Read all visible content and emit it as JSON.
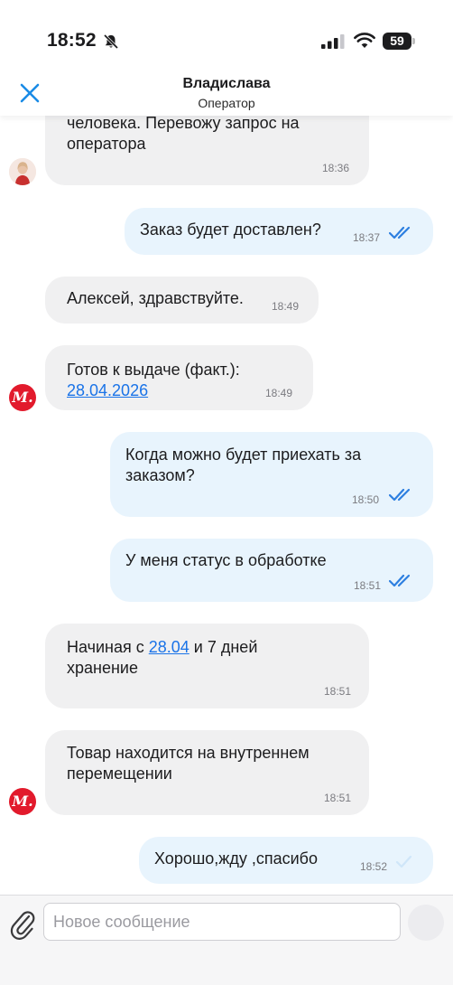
{
  "status_bar": {
    "time": "18:52",
    "battery": "59",
    "icons": [
      "bell-muted-icon",
      "cellular-signal-icon",
      "wifi-icon",
      "battery-icon"
    ]
  },
  "header": {
    "title": "Владислава",
    "subtitle": "Оператор",
    "close_icon": "close-icon"
  },
  "messages": [
    {
      "direction": "incoming",
      "avatar": "operator-photo",
      "lines": [
        "человека. Перевожу запрос на",
        "оператора"
      ],
      "time": "18:36"
    },
    {
      "direction": "outgoing",
      "text": "Заказ будет доставлен?",
      "time": "18:37",
      "status": "read"
    },
    {
      "direction": "incoming",
      "text": "Алексей, здравствуйте.",
      "time": "18:49"
    },
    {
      "direction": "incoming",
      "avatar": "brand-logo",
      "line1": "Готов к выдаче (факт.):",
      "link": "28.04.2026",
      "time": "18:49"
    },
    {
      "direction": "outgoing",
      "lines": [
        "Когда можно будет приехать за",
        "заказом?"
      ],
      "time": "18:50",
      "status": "read"
    },
    {
      "direction": "outgoing",
      "text": "У меня статус в обработке",
      "time": "18:51",
      "status": "read"
    },
    {
      "direction": "incoming",
      "prefix": "Начиная с ",
      "link": "28.04",
      "suffix": " и 7 дней",
      "line2": "хранение",
      "time": "18:51"
    },
    {
      "direction": "incoming",
      "avatar": "brand-logo",
      "lines": [
        "Товар находится на внутреннем",
        "перемещении"
      ],
      "time": "18:51"
    },
    {
      "direction": "outgoing",
      "text": "Хорошо,жду ,спасибо",
      "time": "18:52",
      "status": "sent"
    }
  ],
  "brand_avatar_text": "M.",
  "composer": {
    "placeholder": "Новое сообщение",
    "value": ""
  },
  "colors": {
    "accent": "#1a73e8",
    "incoming_bubble": "#f0f0f1",
    "outgoing_bubble": "#e8f4fd",
    "brand": "#e21a2c",
    "read_tick": "#2d7fe0",
    "sent_tick": "#cfe6f9"
  }
}
